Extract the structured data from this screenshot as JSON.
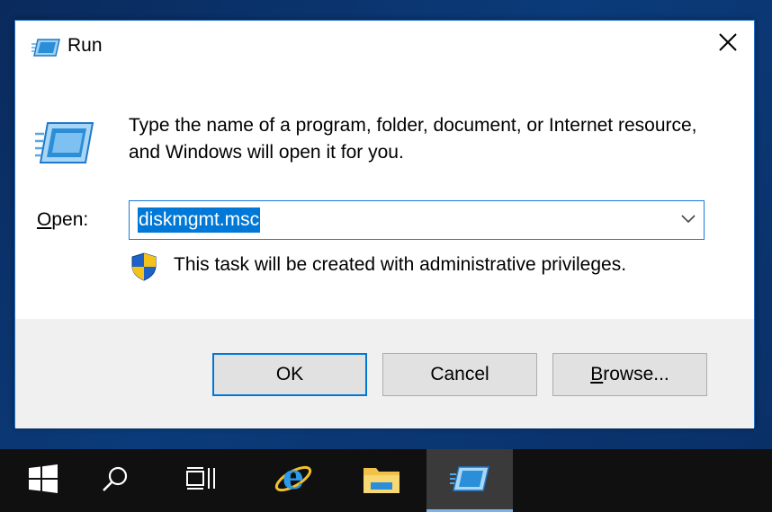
{
  "dialog": {
    "title": "Run",
    "description": "Type the name of a program, folder, document, or Internet resource, and Windows will open it for you.",
    "open_label_accel": "O",
    "open_label_rest": "pen:",
    "input_value": "diskmgmt.msc",
    "admin_note": "This task will be created with administrative privileges.",
    "buttons": {
      "ok": "OK",
      "cancel": "Cancel",
      "browse_accel": "B",
      "browse_rest": "rowse..."
    }
  },
  "taskbar": {
    "items": [
      "windows-start",
      "search",
      "task-view",
      "internet-explorer",
      "file-explorer",
      "run"
    ]
  },
  "colors": {
    "accent": "#0078d7",
    "taskbar": "#101010",
    "footer": "#f0f0f0"
  }
}
